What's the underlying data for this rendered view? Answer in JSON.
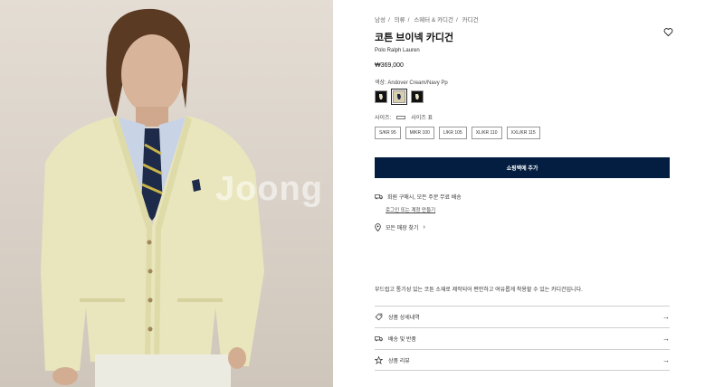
{
  "watermark": "Joong",
  "breadcrumb": [
    "남성",
    "의류",
    "스웨터 & 카디건",
    "카디건"
  ],
  "product": {
    "title": "코튼 브이넥 카디건",
    "brand": "Polo Ralph Lauren",
    "price": "₩369,000"
  },
  "color": {
    "label": "색상: Andover Cream/Navy Pp",
    "swatch_fills": [
      "#111111",
      "#d9cfae",
      "#111111"
    ]
  },
  "size": {
    "label": "사이즈:",
    "guide": "사이즈 표",
    "options": [
      "S/KR 95",
      "M/KR 100",
      "L/KR 105",
      "XL/KR 110",
      "XXL/KR 115"
    ]
  },
  "cta": {
    "label": "쇼핑백에 추가"
  },
  "shipping": {
    "text": "회원 구매시, 모든 주문 무료 배송",
    "sub": "로그인 또는 계정 만들기"
  },
  "store": {
    "text": "모든 매장 찾기 "
  },
  "description": "부드럽고 통기성 있는 코튼 소재로 제작되어 편안하고 여유롭게 착용할 수 있는 카디건입니다.",
  "accordion": [
    {
      "label": "상품 상세내역",
      "icon": "tag-icon"
    },
    {
      "label": "배송 및 반품",
      "icon": "truck-icon"
    },
    {
      "label": "상품 리뷰",
      "icon": "star-icon"
    }
  ],
  "colors": {
    "navy": "#041e42",
    "cardigan": "#e9e6bd"
  }
}
